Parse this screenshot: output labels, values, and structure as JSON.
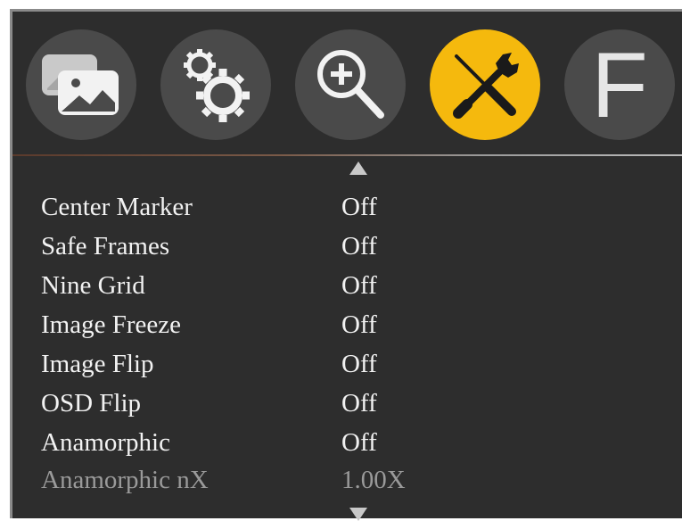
{
  "tabs": [
    {
      "name": "picture-icon",
      "label": "",
      "active": false
    },
    {
      "name": "settings-gears-icon",
      "label": "",
      "active": false
    },
    {
      "name": "zoom-in-icon",
      "label": "",
      "active": false
    },
    {
      "name": "tools-icon",
      "label": "",
      "active": true
    },
    {
      "name": "function-f-icon",
      "label": "F",
      "active": false
    }
  ],
  "colors": {
    "background": "#2d2d2d",
    "tab_inactive": "#4a4a4a",
    "tab_active": "#f5b90d",
    "text": "#f2f2f2",
    "text_disabled": "#9a9a9a"
  },
  "menu": {
    "items": [
      {
        "label": "Center Marker",
        "value": "Off",
        "enabled": true
      },
      {
        "label": "Safe Frames",
        "value": "Off",
        "enabled": true
      },
      {
        "label": "Nine Grid",
        "value": "Off",
        "enabled": true
      },
      {
        "label": "Image Freeze",
        "value": "Off",
        "enabled": true
      },
      {
        "label": "Image Flip",
        "value": "Off",
        "enabled": true
      },
      {
        "label": "OSD Flip",
        "value": "Off",
        "enabled": true
      },
      {
        "label": "Anamorphic",
        "value": "Off",
        "enabled": true
      },
      {
        "label": "Anamorphic nX",
        "value": "1.00X",
        "enabled": false
      }
    ]
  }
}
